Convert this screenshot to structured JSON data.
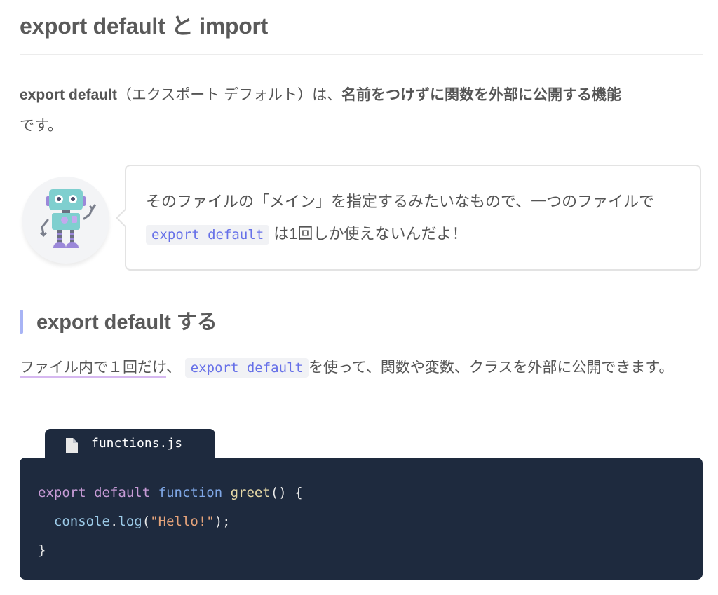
{
  "heading": {
    "title": "export default と import"
  },
  "intro": {
    "term": "export default",
    "reading": "（エクスポート デフォルト）は、",
    "emphasis": "名前をつけずに関数を外部に公開する機能",
    "tail": "です。"
  },
  "tip": {
    "text_before": "そのファイルの「メイン」を指定するみたいなもので、一つのファイルで",
    "code": "export default",
    "text_after": "は1回しか使えないんだよ！"
  },
  "section": {
    "title": "export default する",
    "highlight": "ファイル内で１回だけ",
    "comma": "、",
    "code": "export default",
    "text_after": "を使って、関数や変数、クラスを外部に公開できます。"
  },
  "code_file": {
    "filename": "functions.js",
    "lines": {
      "l1_export": "export",
      "l1_default": "default",
      "l1_function": "function",
      "l1_name": "greet",
      "l1_rest": "() {",
      "l2_obj": "console",
      "l2_dot": ".",
      "l2_method": "log",
      "l2_open": "(",
      "l2_str": "\"Hello!\"",
      "l2_close": ");",
      "l3": "}"
    }
  },
  "icons": {
    "avatar": "robot-icon",
    "file": "file-icon"
  },
  "colors": {
    "code_bg": "#1e2a3e",
    "inline_code": "#6670e8",
    "heading_bar": "#a8b4f5",
    "highlight_underline": "#d6b8f0"
  }
}
